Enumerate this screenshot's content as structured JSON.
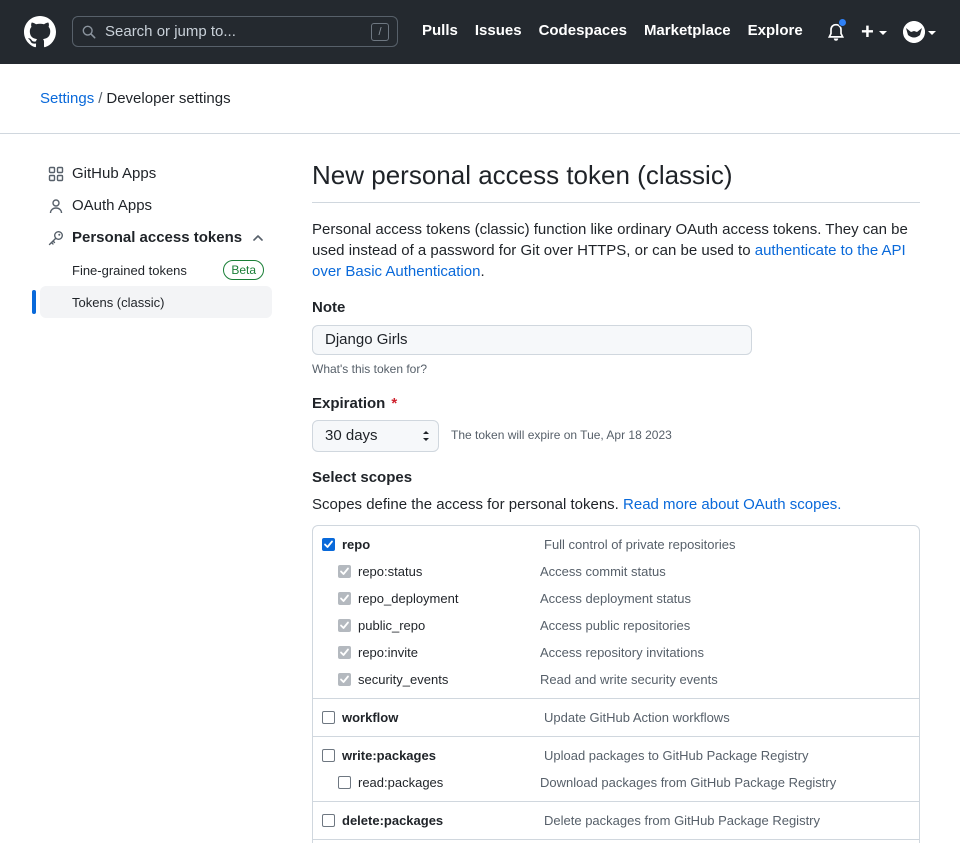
{
  "header": {
    "search_placeholder": "Search or jump to...",
    "search_shortcut": "/",
    "nav": [
      "Pulls",
      "Issues",
      "Codespaces",
      "Marketplace",
      "Explore"
    ],
    "plus": "+"
  },
  "breadcrumb": {
    "root": "Settings",
    "separator": "/",
    "current": "Developer settings"
  },
  "sidebar": {
    "items": [
      {
        "label": "GitHub Apps",
        "icon": "apps-icon"
      },
      {
        "label": "OAuth Apps",
        "icon": "person-icon"
      },
      {
        "label": "Personal access tokens",
        "icon": "key-icon"
      }
    ],
    "subitems": [
      {
        "label": "Fine-grained tokens",
        "badge": "Beta"
      },
      {
        "label": "Tokens (classic)"
      }
    ]
  },
  "main": {
    "title": "New personal access token (classic)",
    "intro_text": "Personal access tokens (classic) function like ordinary OAuth access tokens. They can be used instead of a password for Git over HTTPS, or can be used to ",
    "intro_link": "authenticate to the API over Basic Authentication",
    "intro_end": ".",
    "note_label": "Note",
    "note_value": "Django Girls",
    "note_hint": "What's this token for?",
    "expiration_label": "Expiration",
    "required_mark": "*",
    "expiration_value": "30 days",
    "expiration_text": "The token will expire on Tue, Apr 18 2023",
    "scopes_label": "Select scopes",
    "scopes_desc": "Scopes define the access for personal tokens. ",
    "scopes_link": "Read more about OAuth scopes."
  },
  "scopes": {
    "repo": {
      "name": "repo",
      "desc": "Full control of private repositories"
    },
    "repo_children": [
      {
        "name": "repo:status",
        "desc": "Access commit status"
      },
      {
        "name": "repo_deployment",
        "desc": "Access deployment status"
      },
      {
        "name": "public_repo",
        "desc": "Access public repositories"
      },
      {
        "name": "repo:invite",
        "desc": "Access repository invitations"
      },
      {
        "name": "security_events",
        "desc": "Read and write security events"
      }
    ],
    "workflow": {
      "name": "workflow",
      "desc": "Update GitHub Action workflows"
    },
    "write_packages": {
      "name": "write:packages",
      "desc": "Upload packages to GitHub Package Registry"
    },
    "read_packages": {
      "name": "read:packages",
      "desc": "Download packages from GitHub Package Registry"
    },
    "delete_packages": {
      "name": "delete:packages",
      "desc": "Delete packages from GitHub Package Registry"
    }
  }
}
